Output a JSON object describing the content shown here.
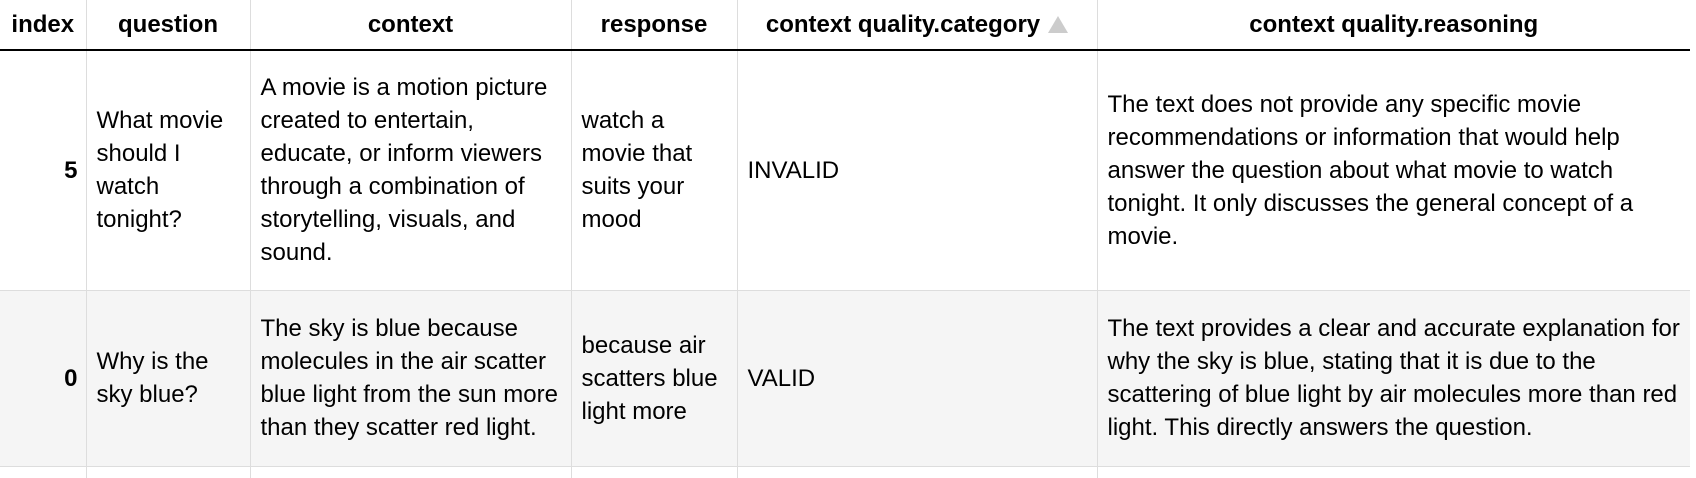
{
  "table": {
    "columns": [
      {
        "key": "index",
        "label": "index"
      },
      {
        "key": "question",
        "label": "question"
      },
      {
        "key": "context",
        "label": "context"
      },
      {
        "key": "response",
        "label": "response"
      },
      {
        "key": "category",
        "label": "context quality.category",
        "sorted": "ascending",
        "sort_icon": "sort-ascending-triangle-icon"
      },
      {
        "key": "reasoning",
        "label": "context quality.reasoning"
      }
    ],
    "rows": [
      {
        "index": "5",
        "question": "What movie should I watch tonight?",
        "context": "A movie is a motion picture created to entertain, educate, or inform viewers through a combination of storytelling, visuals, and sound.",
        "response": "watch a movie that suits your mood",
        "category": "INVALID",
        "reasoning": "The text does not provide any specific movie recommendations or information that would help answer the question about what movie to watch tonight. It only discusses the general concept of a movie."
      },
      {
        "index": "0",
        "question": "Why is the sky blue?",
        "context": "The sky is blue because molecules in the air scatter blue light from the sun more than they scatter red light.",
        "response": "because air scatters blue light more",
        "category": "VALID",
        "reasoning": "The text provides a clear and accurate explanation for why the sky is blue, stating that it is due to the scattering of blue light by air molecules more than red light. This directly answers the question."
      }
    ]
  },
  "colors": {
    "header_border": "#000000",
    "cell_border": "#dddddd",
    "row_alt_background": "#f5f5f5",
    "sort_icon": "#cccccc"
  }
}
